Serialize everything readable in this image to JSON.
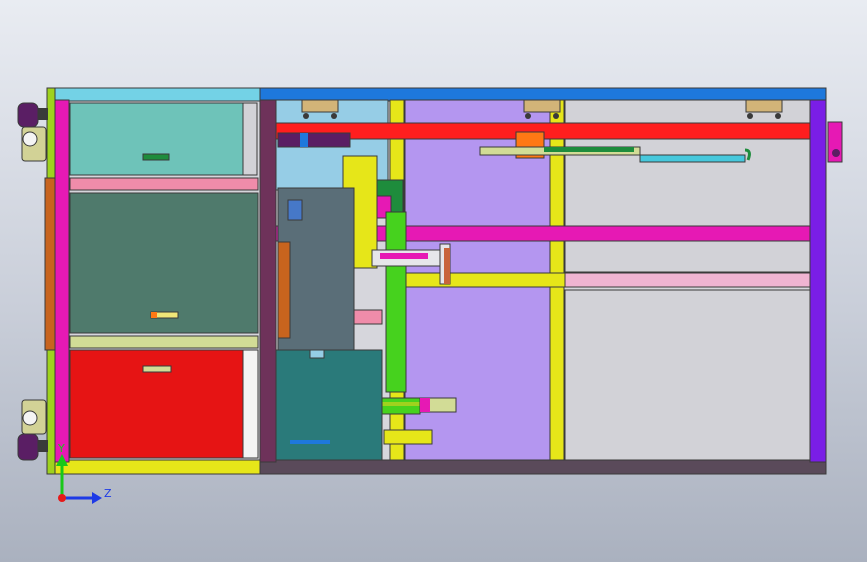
{
  "viewport": {
    "background_top": "#e9ecf2",
    "background_bottom": "#aab1bf"
  },
  "triad": {
    "y_label": "Y",
    "z_label": "Z",
    "y_color": "#19c819",
    "z_color": "#1e3ae6",
    "x_color": "#e61919"
  },
  "colors": {
    "outline": "#3a3a3a",
    "frame_magenta": "#e619b4",
    "frame_blue": "#1e78dc",
    "frame_cyan": "#73d2e6",
    "frame_yellow": "#e6e619",
    "frame_purple": "#6e325a",
    "frame_dark_gray": "#5a4a5a",
    "panel_teal": "#6ec3b9",
    "panel_dark_teal": "#4a7a6a",
    "panel_red": "#e61414",
    "panel_pink": "#f08caa",
    "panel_lavender": "#b496f0",
    "panel_light_gray": "#d2d2d7",
    "rail_red": "#ff1e1e",
    "violet": "#7a1ee6",
    "green": "#46d21e",
    "orange": "#ff7814",
    "brown": "#c8641e"
  }
}
